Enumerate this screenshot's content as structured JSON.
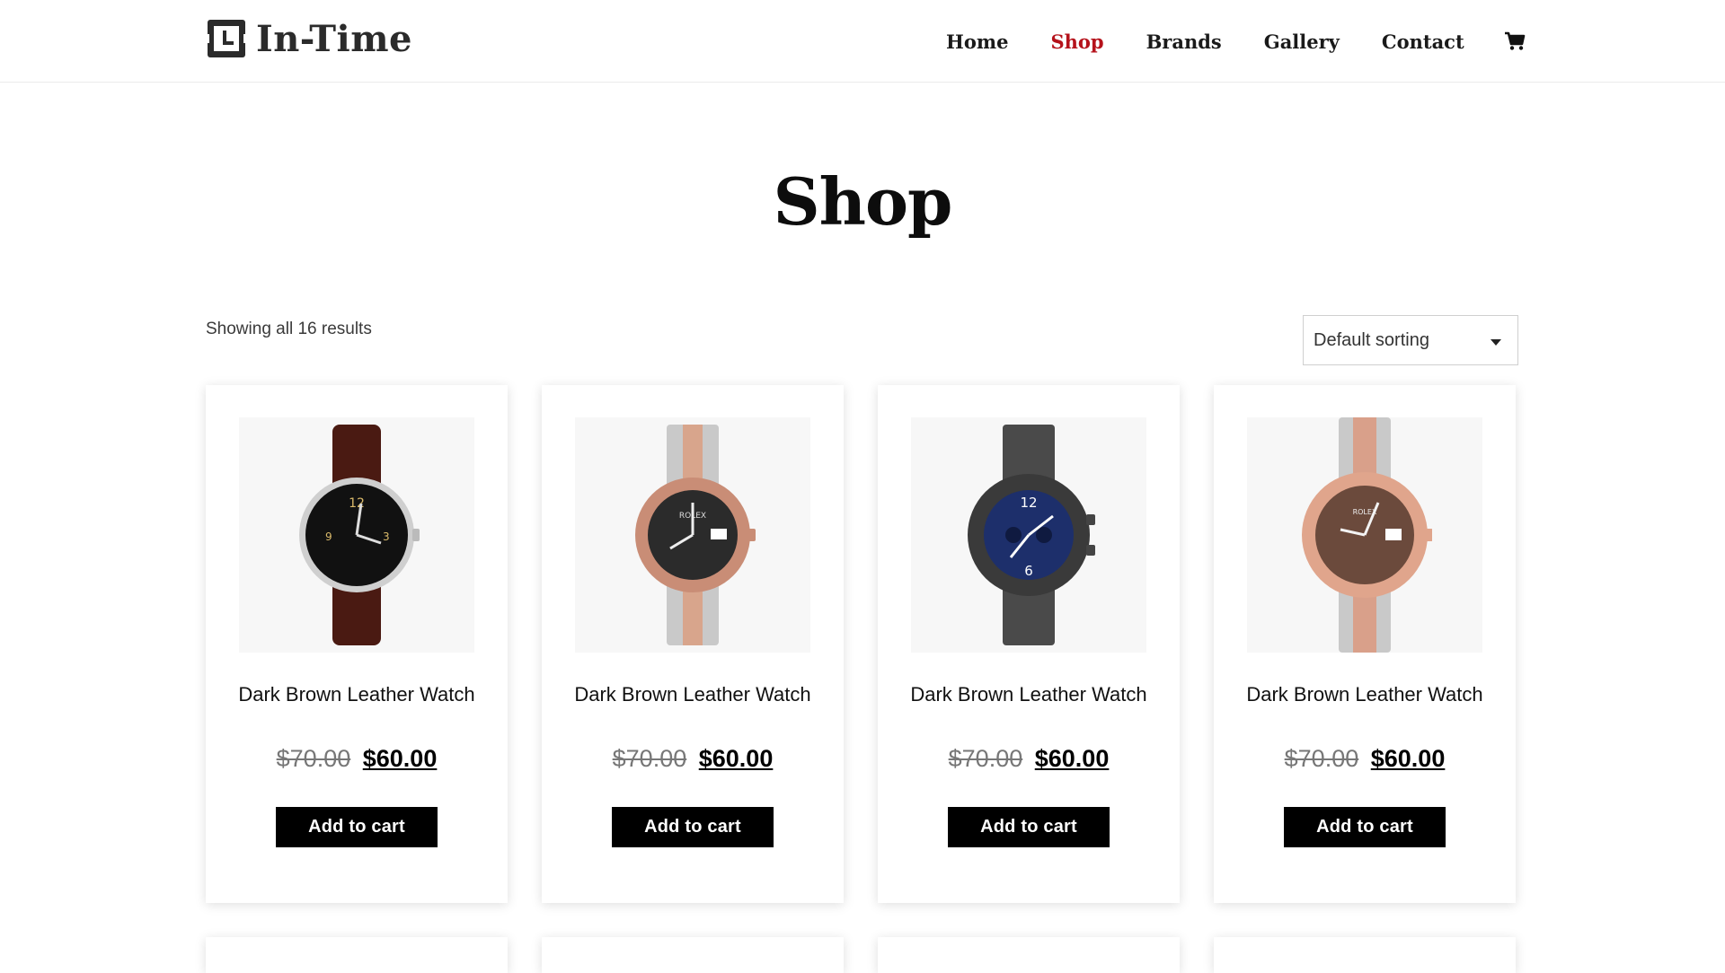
{
  "header": {
    "logo_text": "In-Time",
    "nav": [
      {
        "label": "Home",
        "active": false
      },
      {
        "label": "Shop",
        "active": true
      },
      {
        "label": "Brands",
        "active": false
      },
      {
        "label": "Gallery",
        "active": false
      },
      {
        "label": "Contact",
        "active": false
      }
    ],
    "cart_icon": "shopping-cart-icon",
    "accent_color": "#b5121b"
  },
  "page": {
    "title": "Shop",
    "result_count": "Showing all 16 results",
    "sort": {
      "selected": "Default sorting",
      "icon": "caret-down-icon"
    }
  },
  "products": [
    {
      "name": "Dark Brown Leather Watch",
      "old_price": "$70.00",
      "price": "$60.00",
      "button": "Add to cart",
      "image": "black-dial-leather-strap-watch"
    },
    {
      "name": "Dark Brown Leather Watch",
      "old_price": "$70.00",
      "price": "$60.00",
      "button": "Add to cart",
      "image": "rolex-jubilee-two-tone-watch"
    },
    {
      "name": "Dark Brown Leather Watch",
      "old_price": "$70.00",
      "price": "$60.00",
      "button": "Add to cart",
      "image": "blue-chronograph-gunmetal-watch"
    },
    {
      "name": "Dark Brown Leather Watch",
      "old_price": "$70.00",
      "price": "$60.00",
      "button": "Add to cart",
      "image": "rolex-datejust-rose-gold-watch"
    }
  ]
}
